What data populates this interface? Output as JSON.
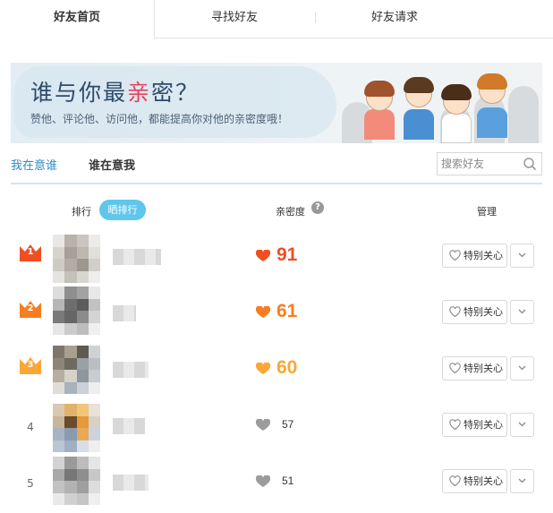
{
  "top_tabs": [
    {
      "label": "好友首页",
      "active": true
    },
    {
      "label": "寻找好友",
      "active": false
    },
    {
      "label": "好友请求",
      "active": false
    }
  ],
  "banner": {
    "title_prefix": "谁与你最",
    "title_highlight": "亲",
    "title_suffix": "密？",
    "subtitle": "赞他、评论他、访问他，都能提高你对他的亲密度哦！"
  },
  "sub_tabs": [
    {
      "label": "我在意谁",
      "active": false
    },
    {
      "label": "谁在意我",
      "active": true
    }
  ],
  "search": {
    "placeholder": "搜索好友"
  },
  "header": {
    "rank_label": "排行",
    "show_rank_button": "晒排行",
    "intimacy_label": "亲密度",
    "manage_label": "管理"
  },
  "rows": [
    {
      "rank": "1",
      "score": "91",
      "care_label": "特别关心"
    },
    {
      "rank": "2",
      "score": "61",
      "care_label": "特别关心"
    },
    {
      "rank": "3",
      "score": "60",
      "care_label": "特别关心"
    },
    {
      "rank": "4",
      "score": "57",
      "care_label": "特别关心"
    },
    {
      "rank": "5",
      "score": "51",
      "care_label": "特别关心"
    }
  ],
  "colors": {
    "rank1": "#f04e23",
    "rank2": "#f77d22",
    "rank3": "#fba735",
    "heart_gray": "#9c9c9c",
    "accent_blue": "#2a8bc7",
    "pill_blue": "#5fc6ec"
  }
}
